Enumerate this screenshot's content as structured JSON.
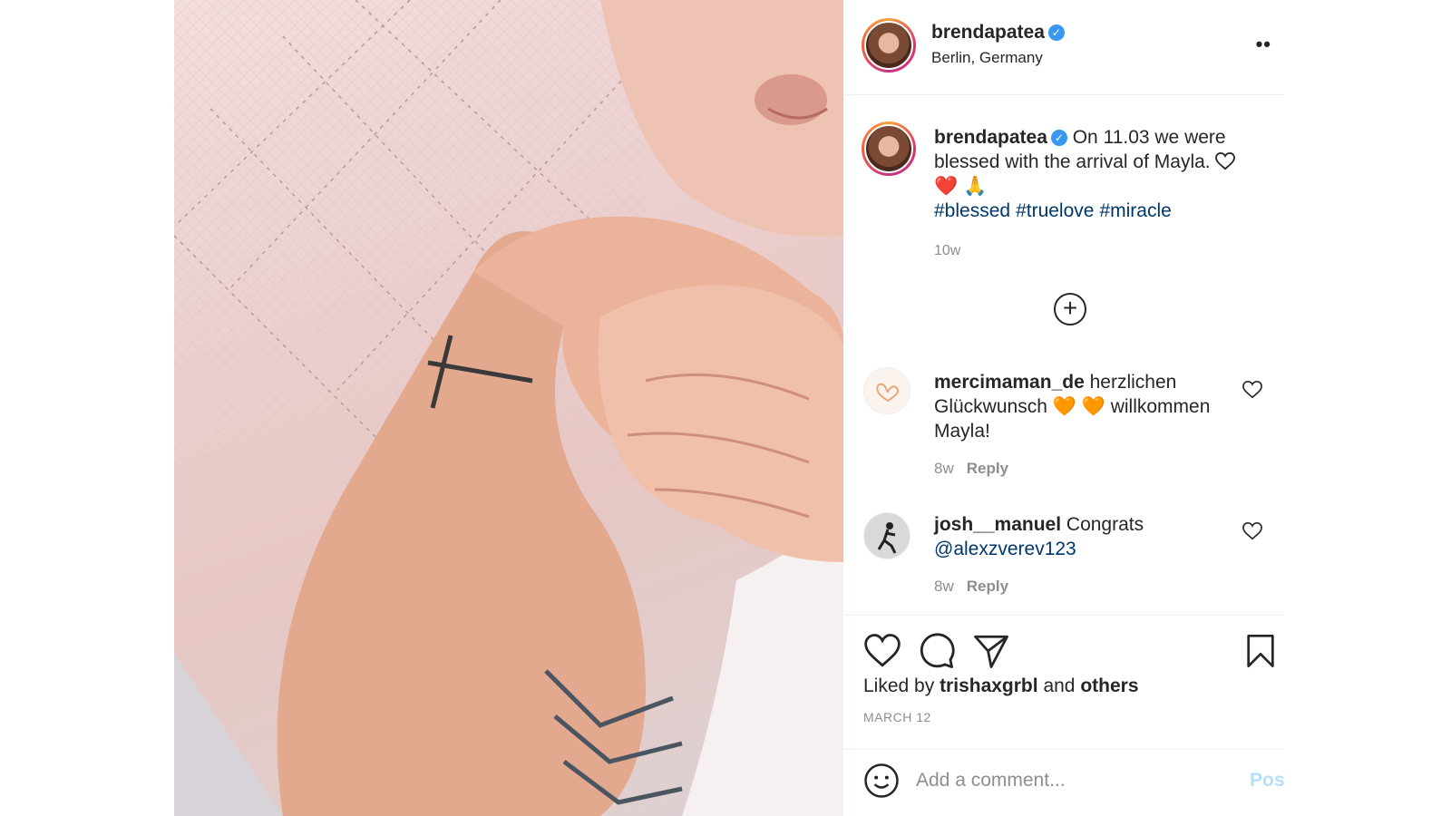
{
  "post": {
    "username": "brendapatea",
    "verified_mark": "✓",
    "location": "Berlin, Germany",
    "more_label": "••"
  },
  "caption": {
    "username": "brendapatea",
    "text": "On 11.03 we were blessed with the arrival of Mayla.",
    "emoji_line": "❤️ 🙏",
    "hashtags": [
      "#blessed",
      "#truelove",
      "#miracle"
    ],
    "time": "10w"
  },
  "load_more_label": "+",
  "comments": [
    {
      "username": "mercimaman_de",
      "text_before": "herzlichen Glückwunsch",
      "emoji": "🧡 🧡",
      "text_after": "willkommen Mayla!",
      "time": "8w",
      "reply_label": "Reply"
    },
    {
      "username": "josh__manuel",
      "text": "Congrats",
      "mention": "@alexzverev123",
      "time": "8w",
      "reply_label": "Reply"
    }
  ],
  "likes": {
    "prefix": "Liked by",
    "user": "trishaxgrbl",
    "conjunction": "and",
    "others": "others"
  },
  "date": "MARCH 12",
  "add_comment": {
    "placeholder": "Add a comment...",
    "post_label": "Post"
  },
  "icons": {
    "like": "heart-icon",
    "comment": "speech-bubble-icon",
    "share": "paper-plane-icon",
    "save": "bookmark-icon",
    "emoji": "smiley-icon",
    "more": "ellipsis-icon"
  },
  "colors": {
    "link": "#00376b",
    "verified": "#3897f0",
    "muted": "#8e8e8e",
    "post_button": "#b2dffc"
  }
}
